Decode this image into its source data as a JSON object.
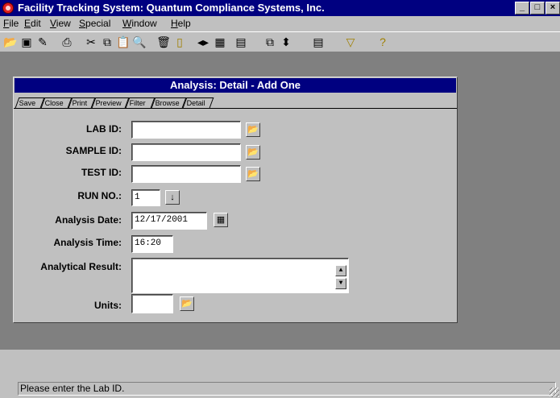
{
  "window": {
    "title": "Facility Tracking System: Quantum Compliance Systems, Inc."
  },
  "menu": [
    {
      "label": "File",
      "key": "F",
      "rest": "ile"
    },
    {
      "label": "Edit",
      "key": "E",
      "rest": "dit"
    },
    {
      "label": "View",
      "key": "V",
      "rest": "iew"
    },
    {
      "label": "Special",
      "key": "S",
      "rest": "pecial"
    },
    {
      "label": "Window",
      "key": "W",
      "rest": "indow"
    },
    {
      "label": "Help",
      "key": "H",
      "rest": "elp"
    }
  ],
  "toolbar_icons": [
    "open-folder-icon",
    "save-icon",
    "edit-icon",
    "print-icon",
    "cut-icon",
    "copy-icon",
    "paste-icon",
    "find-icon",
    "delete-icon",
    "new-icon",
    "nav-arrows-icon",
    "grid-icon",
    "form-icon",
    "copy-window-icon",
    "sort-icon",
    "calendar-icon",
    "filter-icon",
    "help-icon"
  ],
  "form": {
    "title": "Analysis: Detail - Add One",
    "tabs": [
      "Save",
      "Close",
      "Print",
      "Preview",
      "Filter",
      "Browse",
      "Detail"
    ],
    "active_tab": "Detail",
    "lab_id": {
      "label": "LAB ID:",
      "value": ""
    },
    "sample_id": {
      "label": "SAMPLE ID:",
      "value": ""
    },
    "test_id": {
      "label": "TEST ID:",
      "value": ""
    },
    "run_no": {
      "label": "RUN NO.:",
      "value": "1"
    },
    "analysis_date": {
      "label": "Analysis Date:",
      "value": "12/17/2001"
    },
    "analysis_time": {
      "label": "Analysis Time:",
      "value": "16:20"
    },
    "analytical_result": {
      "label": "Analytical Result:",
      "value": ""
    },
    "units": {
      "label": "Units:",
      "value": ""
    }
  },
  "status": {
    "text": "Please enter the Lab ID."
  }
}
